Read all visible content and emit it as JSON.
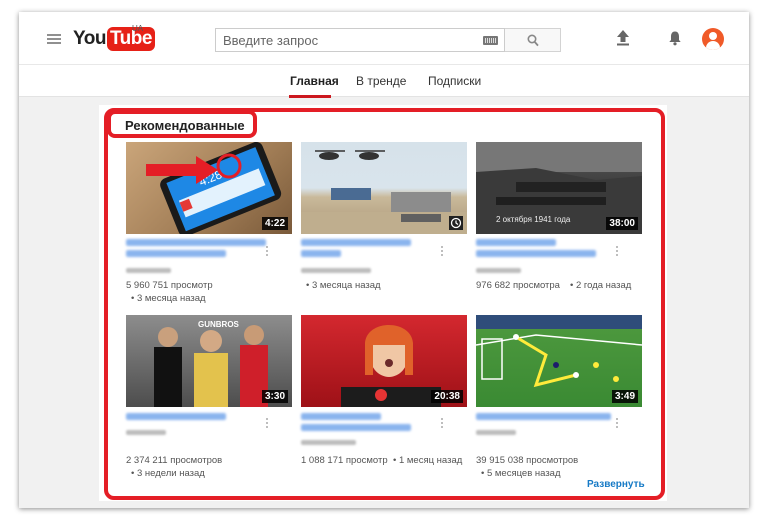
{
  "header": {
    "logo_you": "You",
    "logo_tube": "Tube",
    "region": "UA",
    "search_placeholder": "Введите запрос"
  },
  "tabs": [
    {
      "label": "Главная",
      "active": true
    },
    {
      "label": "В тренде",
      "active": false
    },
    {
      "label": "Подписки",
      "active": false
    }
  ],
  "section": {
    "title": "Рекомендованные",
    "expand_label": "Развернуть"
  },
  "videos": [
    {
      "duration": "4:22",
      "views": "5 960 751 просмотр",
      "age": "• 3 месяца назад"
    },
    {
      "duration": "",
      "views": "",
      "age": "• 3 месяца назад"
    },
    {
      "duration": "38:00",
      "views": "976 682 просмотра",
      "age": "• 2 года назад",
      "overlay": "2 октября 1941 года"
    },
    {
      "duration": "3:30",
      "views": "2 374 211 просмотров",
      "age": "• 3 недели назад",
      "overlay": "GUNBROS"
    },
    {
      "duration": "20:38",
      "views": "1 088 171 просмотр",
      "age": "• 1 месяц назад"
    },
    {
      "duration": "3:49",
      "views": "39 915 038 просмотров",
      "age": "• 5 месяцев назад"
    }
  ],
  "icons": [
    "menu-icon",
    "keyboard-icon",
    "search-icon",
    "upload-icon",
    "bell-icon",
    "avatar"
  ],
  "colors": {
    "accent_red": "#e41e26",
    "link_blue": "#167ac6",
    "logo_red": "#e62117"
  }
}
